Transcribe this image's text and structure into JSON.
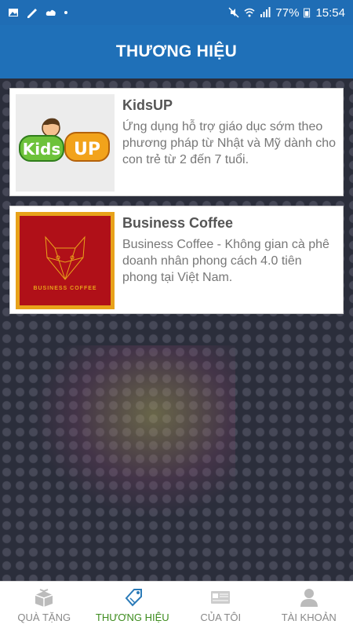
{
  "status": {
    "battery": "77%",
    "time": "15:54"
  },
  "header": {
    "title": "THƯƠNG HIỆU"
  },
  "brands": [
    {
      "name": "KidsUP",
      "description": "Ứng dụng hỗ trợ giáo dục sớm theo phương pháp từ Nhật và Mỹ dành cho con trẻ từ 2 đến 7 tuổi.",
      "logo_icon": "kidsup-logo"
    },
    {
      "name": "Business Coffee",
      "description": "Business Coffee - Không gian cà phê doanh nhân phong cách 4.0 tiên phong tại Việt Nam.",
      "logo_icon": "business-coffee-logo",
      "logo_text": "BUSINESS COFFEE"
    }
  ],
  "nav": [
    {
      "label": "QUÀ TẶNG",
      "icon": "gift-box-icon",
      "active": false
    },
    {
      "label": "THƯƠNG HIỆU",
      "icon": "tag-icon",
      "active": true
    },
    {
      "label": "CỦA TÔI",
      "icon": "card-icon",
      "active": false
    },
    {
      "label": "TÀI KHOẢN",
      "icon": "user-icon",
      "active": false
    }
  ],
  "colors": {
    "primary": "#1f70b8",
    "active_nav": "#3d8c1e"
  }
}
